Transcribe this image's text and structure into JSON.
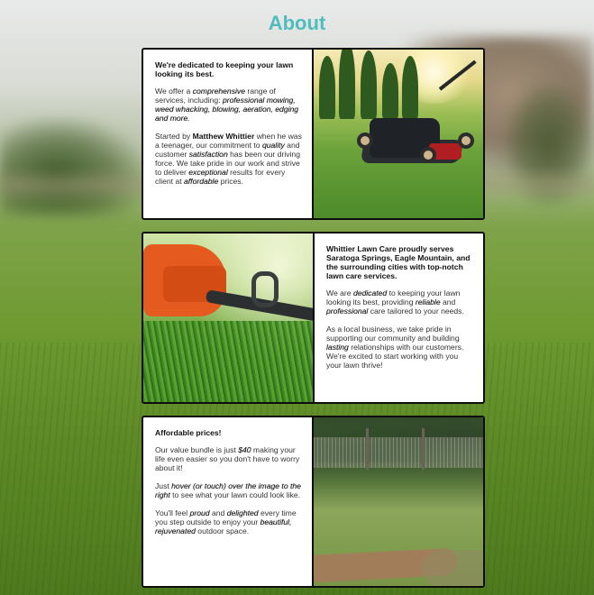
{
  "page": {
    "title": "About"
  },
  "colors": {
    "title": "#4fbcbd",
    "card_border": "#0d0d0d"
  },
  "cards": [
    {
      "heading": "We're dedicated to keeping your lawn looking its best.",
      "p1": {
        "t1": "We offer a ",
        "e1": "comprehensive",
        "t2": " range of services, including: ",
        "e2": "professional mowing, weed whacking, blowing, aeration, edging and more."
      },
      "p2": {
        "t1": "Started by ",
        "b1": "Matthew Whittier",
        "t2": " when he was a teenager, our commitment to ",
        "e1": "quality",
        "t3": " and customer ",
        "e2": "satisfaction",
        "t4": " has been our driving force. We take pride in our work and strive to deliver ",
        "e3": "exceptional",
        "t5": " results for every client at ",
        "e4": "affordable",
        "t6": " prices."
      },
      "image": "lawn-mower-photo"
    },
    {
      "heading": "Whittier Lawn Care proudly serves Saratoga Springs, Eagle Mountain, and the surrounding cities with top-notch lawn care services.",
      "p1": {
        "t1": "We are ",
        "e1": "dedicated",
        "t2": " to keeping your lawn looking its best, providing ",
        "e2": "reliable",
        "t3": " and ",
        "e3": "professional",
        "t4": " care tailored to your needs."
      },
      "p2": {
        "t1": "As a local business, we take pride in supporting our community and building ",
        "e1": "lasting",
        "t2": " relationships with our customers. We're excited to start working with you your lawn thrive!"
      },
      "image": "string-trimmer-photo"
    },
    {
      "heading": "Affordable prices!",
      "p1": {
        "t1": "Our value bundle is just ",
        "e1": "$40",
        "t2": " making your life even easier so you don't have to worry about it!"
      },
      "p2": {
        "t1": "Just ",
        "e1": "hover (or touch) over the image to the right",
        "t2": " to see what your lawn could look like."
      },
      "p3": {
        "t1": "You'll feel ",
        "e1": "proud",
        "t2": " and ",
        "e2": "delighted",
        "t3": " every time you step outside to enjoy your ",
        "e3": "beautiful, rejuvenated",
        "t4": " outdoor space."
      },
      "image": "unkempt-yard-photo"
    }
  ]
}
